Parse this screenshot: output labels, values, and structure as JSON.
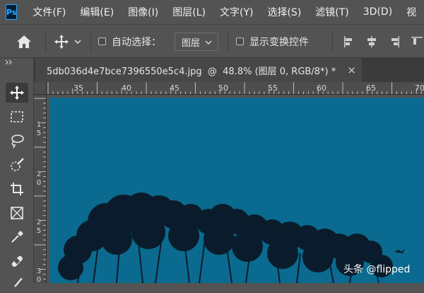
{
  "app": {
    "logo": "Ps"
  },
  "menu": [
    "文件(F)",
    "编辑(E)",
    "图像(I)",
    "图层(L)",
    "文字(Y)",
    "选择(S)",
    "滤镜(T)",
    "3D(D)",
    "视"
  ],
  "options": {
    "auto_select_label": "自动选择：",
    "auto_select_value": "图层",
    "show_transform_label": "显示变换控件"
  },
  "tab": {
    "title": "5db036d4e7bce7396550e5c4.jpg  @  48.8% (图层 0, RGB/8*) *",
    "close": "×"
  },
  "ruler": {
    "top": [
      "35",
      "40",
      "45",
      "50",
      "55",
      "60",
      "65",
      "70"
    ],
    "left": [
      [
        "1",
        "5"
      ],
      [
        "2",
        "0"
      ],
      [
        "2",
        "5"
      ],
      [
        "3",
        "0"
      ]
    ]
  },
  "canvas": {
    "bg_color": "#0b6a8f",
    "tree_color": "#0a1c2c"
  },
  "watermark": "头条 @flipped"
}
